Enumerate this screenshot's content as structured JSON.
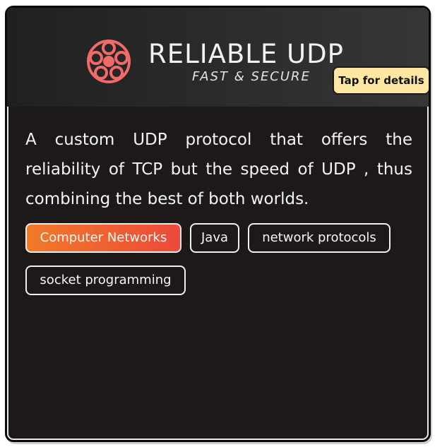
{
  "banner": {
    "title": "RELIABLE UDP",
    "subtitle": "FAST & SECURE",
    "logo_icon": "film-reel-icon",
    "accent_color": "#f06a6a"
  },
  "details_badge": {
    "label": "Tap for details",
    "color": "#fde7a2"
  },
  "description": "A custom UDP protocol that offers the reliability of TCP but the speed of UDP , thus combining the best of both worlds.",
  "tags": [
    {
      "label": "Computer Networks",
      "active": true
    },
    {
      "label": "Java",
      "active": false
    },
    {
      "label": "network protocols",
      "active": false
    },
    {
      "label": "socket programming",
      "active": false
    }
  ],
  "colors": {
    "card_background": "#1c1918",
    "active_tag_gradient_start": "#f07a2a",
    "active_tag_gradient_end": "#ec4a3a"
  }
}
